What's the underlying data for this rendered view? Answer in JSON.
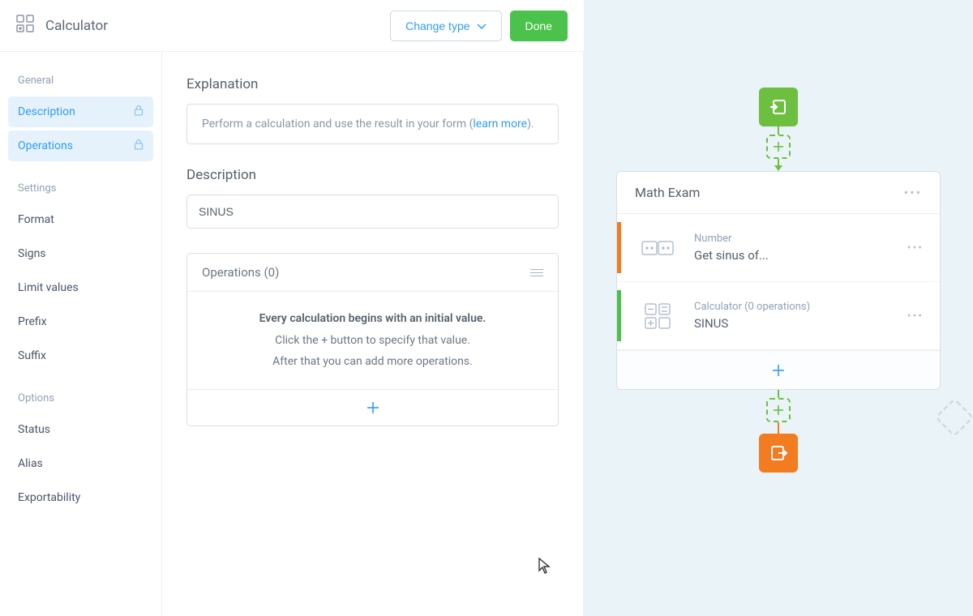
{
  "header": {
    "title": "Calculator",
    "change_type_label": "Change type",
    "done_label": "Done"
  },
  "sidebar": {
    "groups": [
      {
        "label": "General",
        "items": [
          {
            "label": "Description",
            "active": true,
            "locked": true,
            "name": "description"
          },
          {
            "label": "Operations",
            "active": true,
            "locked": true,
            "name": "operations"
          }
        ]
      },
      {
        "label": "Settings",
        "items": [
          {
            "label": "Format",
            "name": "format"
          },
          {
            "label": "Signs",
            "name": "signs"
          },
          {
            "label": "Limit values",
            "name": "limit-values"
          },
          {
            "label": "Prefix",
            "name": "prefix"
          },
          {
            "label": "Suffix",
            "name": "suffix"
          }
        ]
      },
      {
        "label": "Options",
        "items": [
          {
            "label": "Status",
            "name": "status"
          },
          {
            "label": "Alias",
            "name": "alias"
          },
          {
            "label": "Exportability",
            "name": "exportability"
          }
        ]
      }
    ]
  },
  "main": {
    "explanation_title": "Explanation",
    "explanation_text_pre": "Perform a calculation and use the result in your form (",
    "explanation_link": "learn more",
    "explanation_text_post": ").",
    "description_title": "Description",
    "description_value": "SINUS",
    "operations_title": "Operations (0)",
    "ops_empty_line1": "Every calculation begins with an initial value.",
    "ops_empty_line2": "Click the + button to specify that value.",
    "ops_empty_line3": "After that you can add more operations."
  },
  "canvas": {
    "card_title": "Math Exam",
    "rows": [
      {
        "accent": "orange",
        "sub": "Number",
        "title": "Get sinus of...",
        "icon": "number"
      },
      {
        "accent": "green",
        "sub": "Calculator (0 operations)",
        "title": "SINUS",
        "icon": "calculator"
      }
    ]
  },
  "colors": {
    "primary": "#2f9df4",
    "green": "#4bc24b",
    "green_alt": "#6cbf3f",
    "orange": "#f37c20"
  }
}
